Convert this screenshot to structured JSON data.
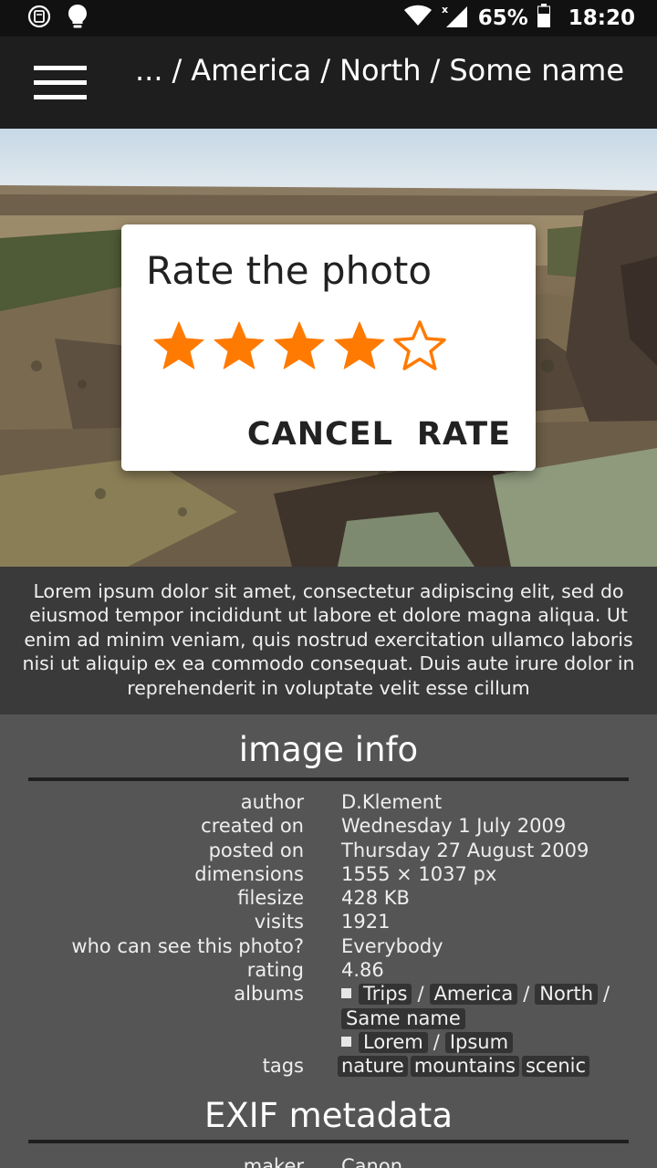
{
  "status_bar": {
    "battery": "65%",
    "time": "18:20"
  },
  "header": {
    "breadcrumb": [
      "...",
      "America",
      "North",
      "Some name"
    ]
  },
  "dialog": {
    "title": "Rate the photo",
    "rating": 4,
    "max_rating": 5,
    "cancel_label": "CANCEL",
    "rate_label": "RATE",
    "star_color": "#FF7A00"
  },
  "description": "Lorem ipsum dolor sit amet, consectetur adipiscing elit, sed do eiusmod tempor incididunt ut labore et dolore magna aliqua. Ut enim ad minim veniam, quis nostrud exercitation ullamco laboris nisi ut aliquip ex ea commodo consequat. Duis aute irure dolor in reprehenderit in voluptate velit esse cillum",
  "image_info": {
    "title": "image info",
    "rows": [
      {
        "key": "author",
        "value": "D.Klement"
      },
      {
        "key": "created on",
        "value": "Wednesday 1 July 2009"
      },
      {
        "key": "posted on",
        "value": "Thursday 27 August 2009"
      },
      {
        "key": "dimensions",
        "value": "1555 × 1037 px"
      },
      {
        "key": "filesize",
        "value": "428 KB"
      },
      {
        "key": "visits",
        "value": "1921"
      },
      {
        "key": "who can see this photo?",
        "value": "Everybody"
      },
      {
        "key": "rating",
        "value": "4.86"
      }
    ],
    "albums_label": "albums",
    "albums": {
      "path1": [
        "Trips",
        "America",
        "North",
        "Same name"
      ],
      "path2": [
        "Lorem",
        "Ipsum"
      ]
    },
    "tags_label": "tags",
    "tags": [
      "nature",
      "mountains",
      "scenic"
    ]
  },
  "exif": {
    "title": "EXIF metadata",
    "first_key": "maker",
    "first_value": "Canon"
  }
}
